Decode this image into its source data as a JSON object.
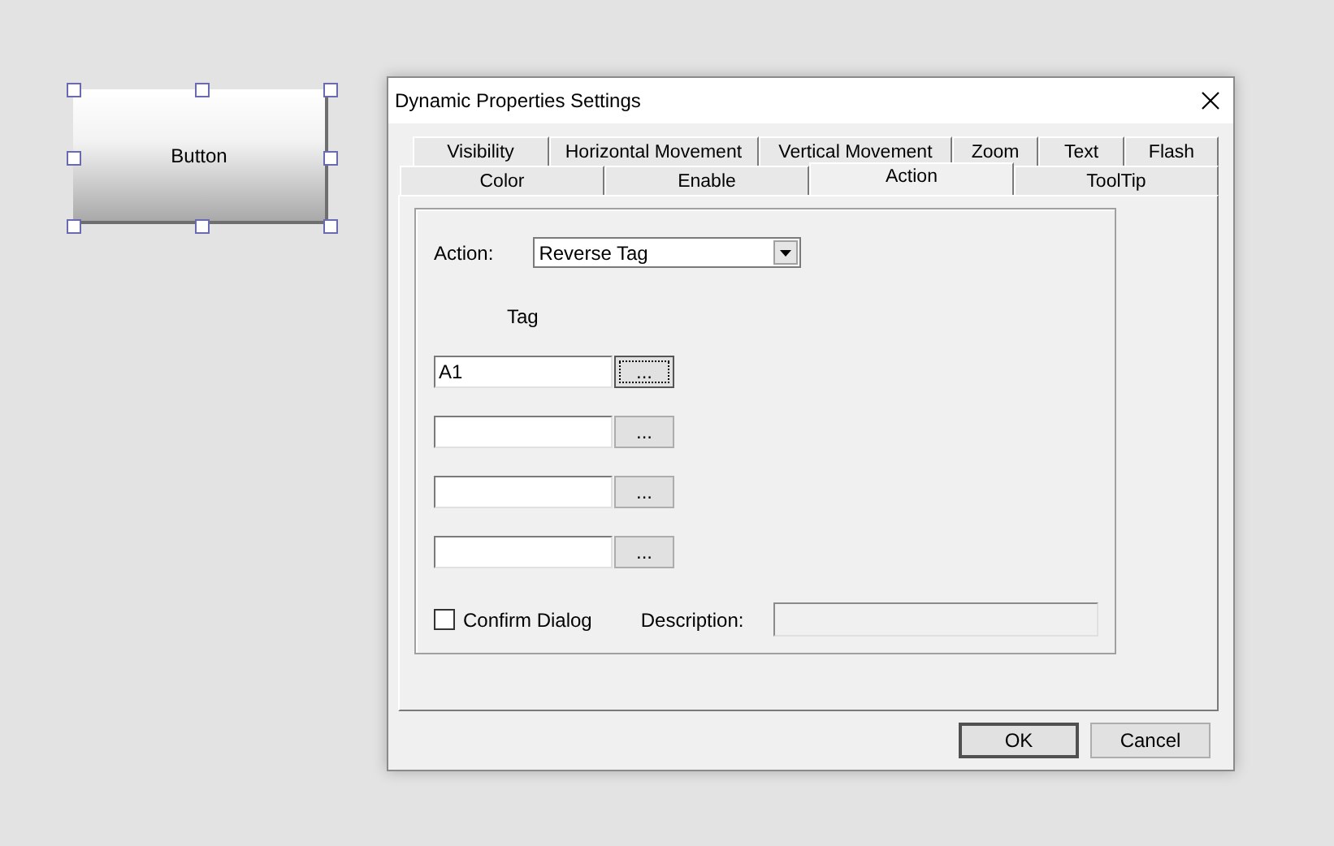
{
  "canvas": {
    "widget": {
      "label": "Button",
      "selected": true
    }
  },
  "dialog": {
    "title": "Dynamic Properties Settings",
    "tab_rows": [
      [
        {
          "label": "Visibility",
          "selected": false
        },
        {
          "label": "Horizontal Movement",
          "selected": false
        },
        {
          "label": "Vertical Movement",
          "selected": false
        },
        {
          "label": "Zoom",
          "selected": false
        },
        {
          "label": "Text",
          "selected": false
        },
        {
          "label": "Flash",
          "selected": false
        }
      ],
      [
        {
          "label": "Color",
          "selected": false
        },
        {
          "label": "Enable",
          "selected": false
        },
        {
          "label": "Action",
          "selected": true
        },
        {
          "label": "ToolTip",
          "selected": false
        }
      ]
    ],
    "action": {
      "label": "Action:",
      "value": "Reverse Tag"
    },
    "tag_heading": "Tag",
    "tags": [
      {
        "value": "A1",
        "button": "...",
        "focused": true
      },
      {
        "button": "...",
        "focused": false
      },
      {
        "button": "...",
        "focused": false
      },
      {
        "button": "...",
        "focused": false
      }
    ],
    "confirm": {
      "label": "Confirm Dialog",
      "checked": false
    },
    "description": {
      "label": "Description:",
      "disabled": true
    },
    "buttons": [
      {
        "label": "OK",
        "default": true
      },
      {
        "label": "Cancel",
        "default": false
      }
    ]
  }
}
